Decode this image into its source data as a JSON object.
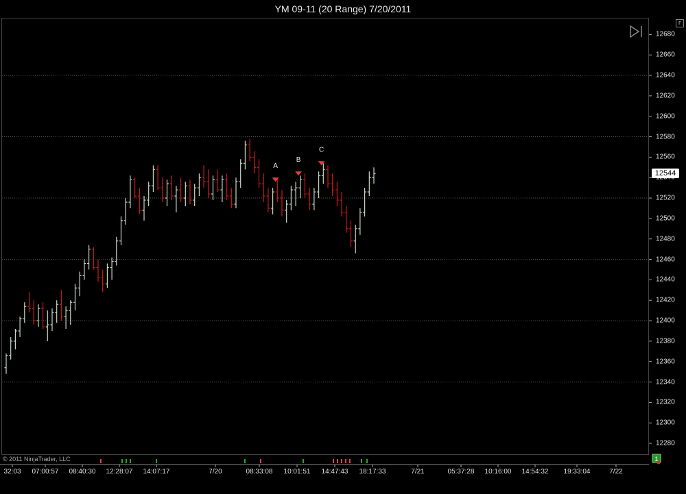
{
  "window": {
    "title": "YM 09-11 (20 Range)  7/20/2011",
    "f_button": "F",
    "copyright": "© 2011 NinjaTrader, LLC",
    "bottom_badge": "1"
  },
  "colors": {
    "background": "#000000",
    "up_bar": "#c8d8c8",
    "down_bar": "#cc1a1a",
    "grid": "#555555",
    "marker": "#e04040",
    "marker_green": "#22aa22"
  },
  "chart_data": {
    "type": "bar",
    "title": "YM 09-11 (20 Range)  7/20/2011",
    "ylim": [
      12270,
      12695
    ],
    "yticks": [
      12280,
      12300,
      12320,
      12340,
      12360,
      12380,
      12400,
      12420,
      12440,
      12460,
      12480,
      12500,
      12520,
      12540,
      12560,
      12580,
      12600,
      12620,
      12640,
      12660,
      12680
    ],
    "ygrid": [
      12340,
      12400,
      12460,
      12520,
      12580,
      12640
    ],
    "current_price": "12544",
    "xtick_labels": [
      "32:03",
      "07:00:57",
      "08:40:30",
      "12:28:07",
      "14:07:17",
      "7/20",
      "08:33:08",
      "10:01:51",
      "14:47:43",
      "18:17:33",
      "7/21",
      "05:37:28",
      "10:16:00",
      "14:54:32",
      "19:33:04",
      "7/22"
    ],
    "bars": [
      {
        "o": 12354,
        "h": 12368,
        "l": 12348,
        "c": 12366
      },
      {
        "o": 12366,
        "h": 12384,
        "l": 12362,
        "c": 12380
      },
      {
        "o": 12380,
        "h": 12392,
        "l": 12372,
        "c": 12390
      },
      {
        "o": 12390,
        "h": 12404,
        "l": 12384,
        "c": 12402
      },
      {
        "o": 12402,
        "h": 12418,
        "l": 12398,
        "c": 12414
      },
      {
        "o": 12414,
        "h": 12428,
        "l": 12408,
        "c": 12412
      },
      {
        "o": 12412,
        "h": 12420,
        "l": 12396,
        "c": 12400
      },
      {
        "o": 12400,
        "h": 12416,
        "l": 12394,
        "c": 12412
      },
      {
        "o": 12412,
        "h": 12418,
        "l": 12392,
        "c": 12394
      },
      {
        "o": 12394,
        "h": 12410,
        "l": 12380,
        "c": 12396
      },
      {
        "o": 12396,
        "h": 12412,
        "l": 12390,
        "c": 12408
      },
      {
        "o": 12408,
        "h": 12420,
        "l": 12398,
        "c": 12416
      },
      {
        "o": 12416,
        "h": 12430,
        "l": 12400,
        "c": 12404
      },
      {
        "o": 12404,
        "h": 12414,
        "l": 12392,
        "c": 12410
      },
      {
        "o": 12410,
        "h": 12420,
        "l": 12396,
        "c": 12418
      },
      {
        "o": 12418,
        "h": 12436,
        "l": 12410,
        "c": 12432
      },
      {
        "o": 12432,
        "h": 12448,
        "l": 12424,
        "c": 12444
      },
      {
        "o": 12444,
        "h": 12460,
        "l": 12440,
        "c": 12456
      },
      {
        "o": 12456,
        "h": 12474,
        "l": 12450,
        "c": 12470
      },
      {
        "o": 12470,
        "h": 12472,
        "l": 12450,
        "c": 12452
      },
      {
        "o": 12452,
        "h": 12460,
        "l": 12438,
        "c": 12442
      },
      {
        "o": 12442,
        "h": 12450,
        "l": 12428,
        "c": 12436
      },
      {
        "o": 12436,
        "h": 12456,
        "l": 12432,
        "c": 12452
      },
      {
        "o": 12452,
        "h": 12462,
        "l": 12440,
        "c": 12458
      },
      {
        "o": 12458,
        "h": 12482,
        "l": 12454,
        "c": 12478
      },
      {
        "o": 12478,
        "h": 12502,
        "l": 12474,
        "c": 12498
      },
      {
        "o": 12498,
        "h": 12520,
        "l": 12494,
        "c": 12516
      },
      {
        "o": 12516,
        "h": 12542,
        "l": 12510,
        "c": 12538
      },
      {
        "o": 12538,
        "h": 12540,
        "l": 12520,
        "c": 12522
      },
      {
        "o": 12522,
        "h": 12530,
        "l": 12504,
        "c": 12508
      },
      {
        "o": 12508,
        "h": 12522,
        "l": 12498,
        "c": 12518
      },
      {
        "o": 12518,
        "h": 12536,
        "l": 12512,
        "c": 12532
      },
      {
        "o": 12532,
        "h": 12552,
        "l": 12526,
        "c": 12548
      },
      {
        "o": 12548,
        "h": 12552,
        "l": 12528,
        "c": 12530
      },
      {
        "o": 12530,
        "h": 12540,
        "l": 12516,
        "c": 12520
      },
      {
        "o": 12520,
        "h": 12538,
        "l": 12512,
        "c": 12534
      },
      {
        "o": 12534,
        "h": 12542,
        "l": 12518,
        "c": 12522
      },
      {
        "o": 12522,
        "h": 12532,
        "l": 12506,
        "c": 12528
      },
      {
        "o": 12528,
        "h": 12540,
        "l": 12516,
        "c": 12520
      },
      {
        "o": 12520,
        "h": 12536,
        "l": 12512,
        "c": 12532
      },
      {
        "o": 12532,
        "h": 12538,
        "l": 12514,
        "c": 12518
      },
      {
        "o": 12518,
        "h": 12534,
        "l": 12512,
        "c": 12530
      },
      {
        "o": 12530,
        "h": 12544,
        "l": 12522,
        "c": 12540
      },
      {
        "o": 12540,
        "h": 12552,
        "l": 12530,
        "c": 12536
      },
      {
        "o": 12536,
        "h": 12548,
        "l": 12520,
        "c": 12524
      },
      {
        "o": 12524,
        "h": 12542,
        "l": 12518,
        "c": 12538
      },
      {
        "o": 12538,
        "h": 12548,
        "l": 12526,
        "c": 12528
      },
      {
        "o": 12528,
        "h": 12542,
        "l": 12516,
        "c": 12538
      },
      {
        "o": 12538,
        "h": 12544,
        "l": 12518,
        "c": 12522
      },
      {
        "o": 12522,
        "h": 12530,
        "l": 12510,
        "c": 12514
      },
      {
        "o": 12514,
        "h": 12540,
        "l": 12510,
        "c": 12536
      },
      {
        "o": 12536,
        "h": 12558,
        "l": 12530,
        "c": 12554
      },
      {
        "o": 12554,
        "h": 12576,
        "l": 12548,
        "c": 12572
      },
      {
        "o": 12572,
        "h": 12578,
        "l": 12556,
        "c": 12560
      },
      {
        "o": 12560,
        "h": 12566,
        "l": 12544,
        "c": 12550
      },
      {
        "o": 12550,
        "h": 12558,
        "l": 12530,
        "c": 12534
      },
      {
        "o": 12534,
        "h": 12544,
        "l": 12516,
        "c": 12522
      },
      {
        "o": 12522,
        "h": 12530,
        "l": 12506,
        "c": 12510
      },
      {
        "o": 12510,
        "h": 12530,
        "l": 12504,
        "c": 12526
      },
      {
        "o": 12526,
        "h": 12540,
        "l": 12516,
        "c": 12520
      },
      {
        "o": 12520,
        "h": 12528,
        "l": 12502,
        "c": 12508
      },
      {
        "o": 12508,
        "h": 12518,
        "l": 12496,
        "c": 12514
      },
      {
        "o": 12514,
        "h": 12532,
        "l": 12508,
        "c": 12528
      },
      {
        "o": 12528,
        "h": 12536,
        "l": 12512,
        "c": 12530
      },
      {
        "o": 12530,
        "h": 12542,
        "l": 12520,
        "c": 12538
      },
      {
        "o": 12538,
        "h": 12544,
        "l": 12520,
        "c": 12524
      },
      {
        "o": 12524,
        "h": 12530,
        "l": 12508,
        "c": 12514
      },
      {
        "o": 12514,
        "h": 12530,
        "l": 12508,
        "c": 12526
      },
      {
        "o": 12526,
        "h": 12546,
        "l": 12520,
        "c": 12542
      },
      {
        "o": 12542,
        "h": 12554,
        "l": 12534,
        "c": 12548
      },
      {
        "o": 12548,
        "h": 12552,
        "l": 12530,
        "c": 12534
      },
      {
        "o": 12534,
        "h": 12544,
        "l": 12522,
        "c": 12528
      },
      {
        "o": 12528,
        "h": 12536,
        "l": 12512,
        "c": 12518
      },
      {
        "o": 12518,
        "h": 12526,
        "l": 12502,
        "c": 12506
      },
      {
        "o": 12506,
        "h": 12512,
        "l": 12486,
        "c": 12490
      },
      {
        "o": 12490,
        "h": 12498,
        "l": 12472,
        "c": 12478
      },
      {
        "o": 12478,
        "h": 12494,
        "l": 12466,
        "c": 12490
      },
      {
        "o": 12490,
        "h": 12510,
        "l": 12484,
        "c": 12506
      },
      {
        "o": 12506,
        "h": 12530,
        "l": 12502,
        "c": 12526
      },
      {
        "o": 12526,
        "h": 12546,
        "l": 12522,
        "c": 12540
      },
      {
        "o": 12540,
        "h": 12550,
        "l": 12534,
        "c": 12544
      }
    ],
    "markers": [
      {
        "label": "A",
        "bar": 58
      },
      {
        "label": "B",
        "bar": 63
      },
      {
        "label": "C",
        "bar": 68
      }
    ]
  }
}
